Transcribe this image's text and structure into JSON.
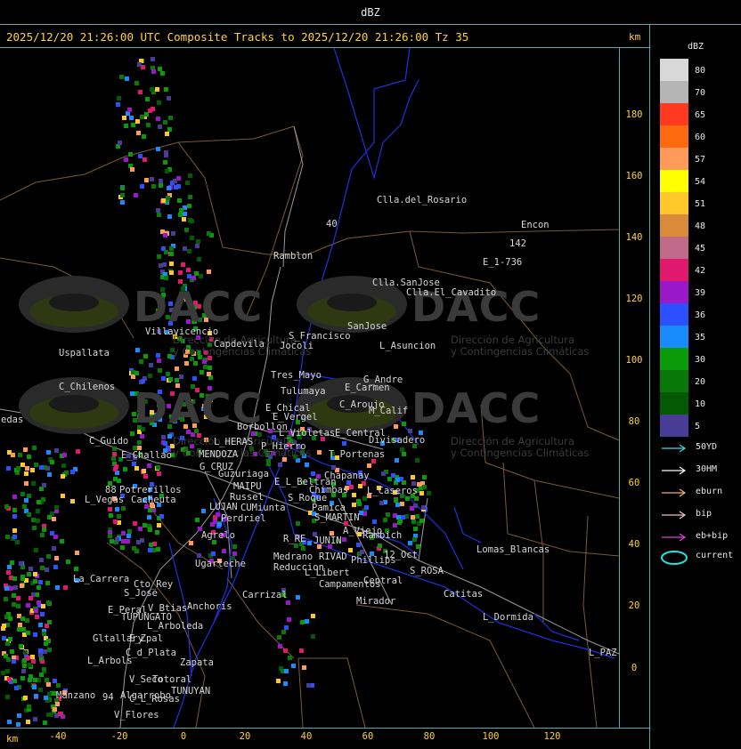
{
  "window": {
    "title": "dBZ"
  },
  "header": {
    "text": "2025/12/20 21:26:00 UTC Composite Tracks to 2025/12/20 21:26:00 Tz 35",
    "km_unit": "km"
  },
  "axes": {
    "unit": "km",
    "y_ticks": [
      "180",
      "160",
      "140",
      "120",
      "100",
      "80",
      "60",
      "40",
      "20",
      "0"
    ],
    "x_ticks": [
      "-40",
      "-20",
      "0",
      "20",
      "40",
      "60",
      "80",
      "100",
      "120"
    ]
  },
  "legend": {
    "title": "dBZ",
    "scale": [
      {
        "label": "80",
        "color": "#d8d8d8"
      },
      {
        "label": "70",
        "color": "#b4b4b4"
      },
      {
        "label": "65",
        "color": "#ff3a1e"
      },
      {
        "label": "60",
        "color": "#ff6a10"
      },
      {
        "label": "57",
        "color": "#ff9a5a"
      },
      {
        "label": "54",
        "color": "#ffff00"
      },
      {
        "label": "51",
        "color": "#ffc82a"
      },
      {
        "label": "48",
        "color": "#d98a3a"
      },
      {
        "label": "45",
        "color": "#c06a8a"
      },
      {
        "label": "42",
        "color": "#e0186e"
      },
      {
        "label": "39",
        "color": "#9a18c8"
      },
      {
        "label": "36",
        "color": "#2a50ff"
      },
      {
        "label": "35",
        "color": "#1a8aff"
      },
      {
        "label": "30",
        "color": "#0a9a0a"
      },
      {
        "label": "20",
        "color": "#087808"
      },
      {
        "label": "10",
        "color": "#045a04"
      },
      {
        "label": "5",
        "color": "#483c96"
      }
    ],
    "tracks": [
      {
        "label": "50YD",
        "color": "#44d8e8"
      },
      {
        "label": "30HM",
        "color": "#ffffff"
      },
      {
        "label": "eburn",
        "color": "#f0b070"
      },
      {
        "label": "bip",
        "color": "#f4c0c8"
      },
      {
        "label": "eb+bip",
        "color": "#e040e0"
      },
      {
        "label": "current",
        "color": "#22e0e0"
      }
    ]
  },
  "watermark": {
    "brand": "DACC",
    "line1": "Dirección de Agricultura",
    "line2": "y Contingencias Climáticas"
  },
  "places": [
    {
      "name": "Clla.del_Rosario"
    },
    {
      "name": "Encon"
    },
    {
      "name": "142"
    },
    {
      "name": "E_1-736"
    },
    {
      "name": "Ramblon"
    },
    {
      "name": "Clla.SanJose"
    },
    {
      "name": "Clla.El_Cavadito"
    },
    {
      "name": "Villavicencio"
    },
    {
      "name": "Capdevila"
    },
    {
      "name": "S_Francisco"
    },
    {
      "name": "Jocoli"
    },
    {
      "name": "SanJose"
    },
    {
      "name": "L_Asuncion"
    },
    {
      "name": "Uspallata"
    },
    {
      "name": "Tres_Mayo"
    },
    {
      "name": "G_Andre"
    },
    {
      "name": "C_Chilenos"
    },
    {
      "name": "Tulumaya"
    },
    {
      "name": "E_Carmen"
    },
    {
      "name": "E_Chical"
    },
    {
      "name": "C_Aroujo"
    },
    {
      "name": "M_Calif"
    },
    {
      "name": "edas"
    },
    {
      "name": "E_Vergel"
    },
    {
      "name": "Borbollon"
    },
    {
      "name": "E_Central"
    },
    {
      "name": "L_Violetas"
    },
    {
      "name": "Divisadero"
    },
    {
      "name": "C_Guido"
    },
    {
      "name": "L_HERAS"
    },
    {
      "name": "P_Hierro"
    },
    {
      "name": "E_Challao"
    },
    {
      "name": "MENDOZA"
    },
    {
      "name": "T_Portenas"
    },
    {
      "name": "G_CRUZ"
    },
    {
      "name": "Guzuriaga"
    },
    {
      "name": "Chapanay"
    },
    {
      "name": "E_L_Beltran"
    },
    {
      "name": "MAIPU"
    },
    {
      "name": "Chimbas"
    },
    {
      "name": "Potrerillos"
    },
    {
      "name": "Cacheuta"
    },
    {
      "name": "L_Vegas"
    },
    {
      "name": "Russel"
    },
    {
      "name": "S_Roque"
    },
    {
      "name": "L_Caseros"
    },
    {
      "name": "LUJAN"
    },
    {
      "name": "CUMiunta"
    },
    {
      "name": "Pamica"
    },
    {
      "name": "Perdriel"
    },
    {
      "name": "S_MARTIN"
    },
    {
      "name": "A_Viejo"
    },
    {
      "name": "Agrelo"
    },
    {
      "name": "Rambich"
    },
    {
      "name": "R_RE"
    },
    {
      "name": "JUNIN"
    },
    {
      "name": "Ugarteche"
    },
    {
      "name": "Medrano"
    },
    {
      "name": "RIVAD"
    },
    {
      "name": "Phillips"
    },
    {
      "name": "12_Oct"
    },
    {
      "name": "Lomas_Blancas"
    },
    {
      "name": "Reduccion"
    },
    {
      "name": "L_Libert"
    },
    {
      "name": "S_ROSA"
    },
    {
      "name": "La_Carrera"
    },
    {
      "name": "Cto_Rey"
    },
    {
      "name": "S_Jose"
    },
    {
      "name": "Campamentos"
    },
    {
      "name": "Central"
    },
    {
      "name": "Carrizal"
    },
    {
      "name": "Catitas"
    },
    {
      "name": "E_Peral"
    },
    {
      "name": "V_Btias"
    },
    {
      "name": "Anchoris"
    },
    {
      "name": "Mirador"
    },
    {
      "name": "TUPUNGATO"
    },
    {
      "name": "L_Dormida"
    },
    {
      "name": "L_Arboleda"
    },
    {
      "name": "Gltallary"
    },
    {
      "name": "E_Zpal"
    },
    {
      "name": "C_d_Plata"
    },
    {
      "name": "L_Arbols"
    },
    {
      "name": "Zapata"
    },
    {
      "name": "L_PAZ"
    },
    {
      "name": "V_Seco"
    },
    {
      "name": "Totoral"
    },
    {
      "name": "TUNUYAN"
    },
    {
      "name": "Algarrobo"
    },
    {
      "name": "Manzano"
    },
    {
      "name": "C_L_Rosas"
    },
    {
      "name": "94"
    },
    {
      "name": "V_Flores"
    },
    {
      "name": "88"
    },
    {
      "name": "40"
    }
  ]
}
